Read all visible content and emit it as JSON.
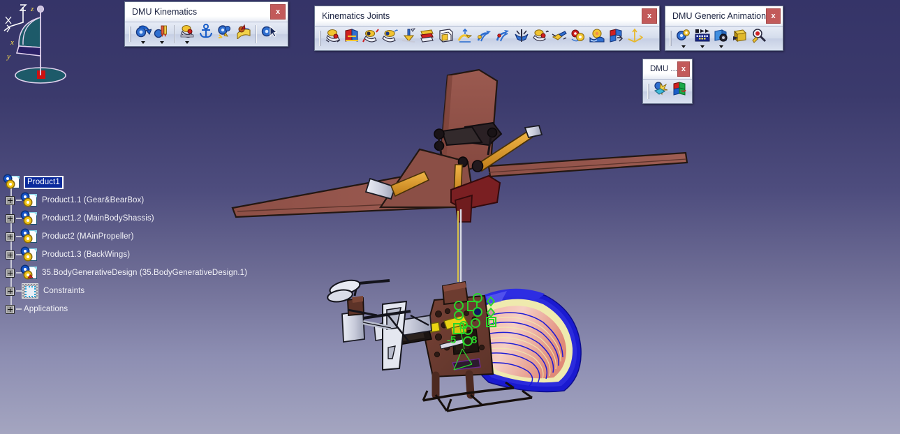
{
  "app": {
    "background_top": "#353468",
    "background_bottom": "#a4a5c0"
  },
  "spec_tree": {
    "root": {
      "label": "Product1",
      "icon": "product-gear-icon",
      "selected": true
    },
    "items": [
      {
        "label": "Product1.1 (Gear&BearBox)",
        "icon": "product-gear-icon"
      },
      {
        "label": "Product1.2 (MainBodyShassis)",
        "icon": "product-gear-icon"
      },
      {
        "label": "Product2 (MAinPropeller)",
        "icon": "product-gear-icon"
      },
      {
        "label": "Product1.3 (BackWings)",
        "icon": "product-gear-icon"
      },
      {
        "label": "35.BodyGenerativeDesign (35.BodyGenerativeDesign.1)",
        "icon": "part-generative-icon"
      },
      {
        "label": "Constraints",
        "icon": "constraints-icon"
      },
      {
        "label": "Applications",
        "icon": "none"
      }
    ]
  },
  "toolbars": [
    {
      "id": "dmu-kinematics",
      "title": "DMU Kinematics",
      "close_label": "x",
      "groups": [
        {
          "buttons": [
            {
              "name": "mechanism-dressup-icon",
              "dropdown": true
            },
            {
              "name": "fixed-part-icon",
              "dropdown": true
            }
          ]
        },
        {
          "buttons": [
            {
              "name": "simulation-with-commands-icon",
              "dropdown": true
            },
            {
              "name": "anchor-fix-part-icon",
              "dropdown": false
            },
            {
              "name": "mechanism-analysis-icon",
              "dropdown": false
            },
            {
              "name": "speed-acceleration-icon",
              "dropdown": false
            }
          ]
        },
        {
          "buttons": [
            {
              "name": "mechanism-select-icon",
              "dropdown": false
            }
          ]
        }
      ]
    },
    {
      "id": "kinematics-joints",
      "title": "Kinematics Joints",
      "close_label": "x",
      "groups": [
        {
          "buttons": [
            {
              "name": "revolute-joint-icon",
              "dropdown": false
            },
            {
              "name": "prismatic-joint-icon",
              "dropdown": false
            },
            {
              "name": "cylindrical-joint-icon",
              "dropdown": false
            },
            {
              "name": "spherical-joint-icon",
              "dropdown": false
            },
            {
              "name": "planar-joint-icon",
              "dropdown": false
            },
            {
              "name": "rigid-joint-icon",
              "dropdown": false
            },
            {
              "name": "point-curve-joint-icon",
              "dropdown": false
            },
            {
              "name": "point-surface-joint-icon",
              "dropdown": false
            },
            {
              "name": "screw-joint-icon",
              "dropdown": false
            },
            {
              "name": "rack-joint-icon",
              "dropdown": false
            },
            {
              "name": "cable-joint-icon",
              "dropdown": false
            },
            {
              "name": "gear-joint-icon",
              "dropdown": false
            },
            {
              "name": "u-joint-icon",
              "dropdown": false
            },
            {
              "name": "roll-curve-joint-icon",
              "dropdown": false
            },
            {
              "name": "slide-curve-joint-icon",
              "dropdown": false
            },
            {
              "name": "axis-joint-icon",
              "dropdown": false
            },
            {
              "name": "axis-system-icon",
              "dropdown": false
            }
          ]
        }
      ]
    },
    {
      "id": "dmu-generic-animation",
      "title": "DMU Generic Animation",
      "close_label": "x",
      "groups": [
        {
          "buttons": [
            {
              "name": "simulation-player-icon",
              "dropdown": true
            },
            {
              "name": "track-editor-icon",
              "dropdown": true
            },
            {
              "name": "camera-viewpoint-icon",
              "dropdown": true
            },
            {
              "name": "compile-simulation-icon",
              "dropdown": false
            },
            {
              "name": "analysis-inspect-icon",
              "dropdown": false
            }
          ]
        }
      ]
    },
    {
      "id": "dmu-space-analysis",
      "title": "DMU ...",
      "close_label": "x",
      "groups": [
        {
          "buttons": [
            {
              "name": "clash-detection-icon",
              "dropdown": false
            },
            {
              "name": "sectioning-icon",
              "dropdown": false
            }
          ]
        }
      ]
    }
  ],
  "compass": {
    "name": "view-compass",
    "labels": {
      "x": "x",
      "y": "y",
      "z": "z"
    },
    "colors": {
      "frame": "#e2d3ee",
      "fill": "#1d5a69",
      "base": "#cc1111",
      "text": "#ffe14d"
    }
  },
  "axis_triad": {
    "name": "axis-system-indicator",
    "labels": {
      "x": "x",
      "y": "y",
      "z": "z"
    },
    "color": "#ffffff"
  },
  "model": {
    "name": "helicopter-assembly",
    "annotations": [
      {
        "text": "-5",
        "color": "#2ad42a"
      },
      {
        "text": "8",
        "color": "#2ad42a"
      }
    ],
    "colors": {
      "rotor_blade": "#8f5148",
      "rotor_blade_light": "#9d5c52",
      "chassis": "#6b3b30",
      "linkage_orange": "#e0a030",
      "metal": "#d7d9e4",
      "joint_marker": "#2ad42a",
      "analysis_blue": "#1414d8",
      "analysis_red": "#e8907e",
      "analysis_yellow": "#efeaae"
    }
  }
}
